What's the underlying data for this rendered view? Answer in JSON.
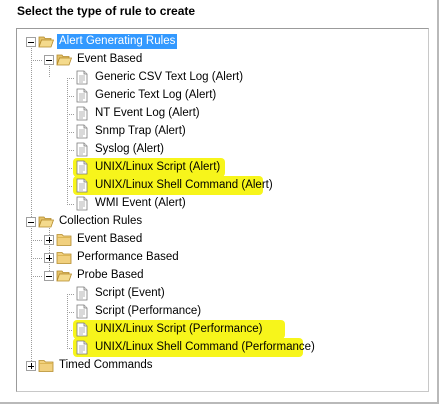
{
  "header": {
    "title": "Select the type of rule to create"
  },
  "tree": {
    "alert_root": {
      "label": "Alert Generating Rules"
    },
    "alert_event_based": {
      "label": "Event Based"
    },
    "alert_items": [
      {
        "label": "Generic CSV Text Log (Alert)",
        "highlighted": false
      },
      {
        "label": "Generic Text Log (Alert)",
        "highlighted": false
      },
      {
        "label": "NT Event Log (Alert)",
        "highlighted": false
      },
      {
        "label": "Snmp Trap (Alert)",
        "highlighted": false
      },
      {
        "label": "Syslog (Alert)",
        "highlighted": false
      },
      {
        "label": "UNIX/Linux Script (Alert)",
        "highlighted": true
      },
      {
        "label": "UNIX/Linux Shell Command (Alert)",
        "highlighted": true
      },
      {
        "label": "WMI Event (Alert)",
        "highlighted": false
      }
    ],
    "collection_root": {
      "label": "Collection Rules"
    },
    "collection_event_based": {
      "label": "Event Based"
    },
    "collection_performance_based": {
      "label": "Performance Based"
    },
    "collection_probe_based": {
      "label": "Probe Based"
    },
    "probe_items": [
      {
        "label": "Script (Event)",
        "highlighted": false
      },
      {
        "label": "Script (Performance)",
        "highlighted": false
      },
      {
        "label": "UNIX/Linux Script (Performance)",
        "highlighted": true
      },
      {
        "label": "UNIX/Linux Shell Command (Performance)",
        "highlighted": true
      }
    ],
    "timed_root": {
      "label": "Timed Commands"
    }
  },
  "colors": {
    "selection": "#3399ff",
    "highlighter": "#f7f51b",
    "folder": "#e8c765"
  },
  "icons": {
    "folder_open": "folder-open-icon",
    "folder_closed": "folder-icon",
    "rule": "rule-document-icon"
  }
}
